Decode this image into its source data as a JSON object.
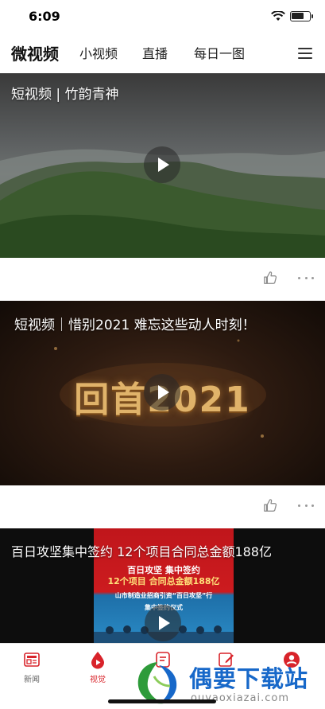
{
  "status_bar": {
    "time": "6:09",
    "battery_level": 0.7
  },
  "top_nav": {
    "tabs": [
      {
        "label": "微视频",
        "active": true
      },
      {
        "label": "小视频",
        "active": false
      },
      {
        "label": "直播",
        "active": false
      },
      {
        "label": "每日一图",
        "active": false
      }
    ],
    "menu_icon": "hamburger-icon"
  },
  "feed": [
    {
      "title": "短视频 | 竹韵青神"
    },
    {
      "title": "短视频｜惜别2021  难忘这些动人时刻！",
      "overlay_text": "回首2021"
    },
    {
      "title": "百日攻坚集中签约 12个项目合同总金额188亿",
      "poster_lines": [
        "百日攻坚  集中签约",
        "12个项目  合同总金额188亿",
        "山市制造业招商引资“百日攻坚”行",
        "集中签约仪式"
      ]
    }
  ],
  "tab_bar": {
    "items": [
      {
        "label": "新闻",
        "icon": "newspaper-icon",
        "active": false
      },
      {
        "label": "视觉",
        "icon": "video-drop-icon",
        "active": true
      },
      {
        "label": "",
        "icon": "document-icon",
        "active": false
      },
      {
        "label": "",
        "icon": "edit-icon",
        "active": false
      },
      {
        "label": "",
        "icon": "user-icon",
        "active": false
      }
    ]
  },
  "watermark": {
    "name": "偶要下载站",
    "url": "ouyaoxiazai.com"
  },
  "colors": {
    "accent": "#d8232a",
    "watermark_blue": "#1768c9"
  }
}
